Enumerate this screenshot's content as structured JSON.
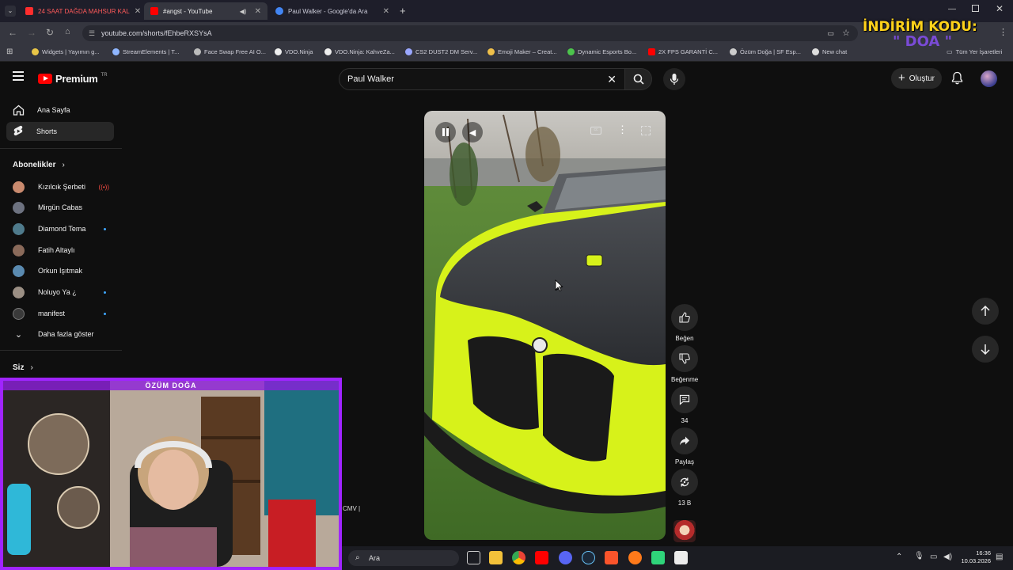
{
  "browser": {
    "tabs": [
      {
        "title": "24 SAAT DAĞDA MAHSUR KAL",
        "color": "#ff2d2d"
      },
      {
        "title": "#angst - YouTube",
        "color": "#ff0000"
      },
      {
        "title": "Paul Walker - Google'da Ara",
        "color": "#4285f4"
      }
    ],
    "url": "youtube.com/shorts/fEhbeRXSYsA",
    "bookmarks": [
      "Widgets | Yayımın g...",
      "StreamElements | T...",
      "Face Swap Free AI O...",
      "VDO.Ninja",
      "VDO.Ninja: KahveZa...",
      "CS2 DUST2 DM Serv...",
      "Emoji Maker – Creat...",
      "Dynamic Esports Bo...",
      "2X FPS GARANTİ C...",
      "Özüm Doğa | SF Esp...",
      "New chat"
    ],
    "bookmarks_folder": "Tüm Yer İşaretleri"
  },
  "promo": {
    "line1": "İNDİRİM KODU:",
    "line2": "\" DOA \""
  },
  "header": {
    "logo_text": "Premium",
    "logo_sup": "TR",
    "search_value": "Paul Walker",
    "create_label": "Oluştur"
  },
  "sidebar": {
    "home": "Ana Sayfa",
    "shorts": "Shorts",
    "subscriptions_title": "Abonelikler",
    "subscriptions": [
      {
        "name": "Kızılcık Şerbeti",
        "badge": "live"
      },
      {
        "name": "Mirgün Cabas",
        "badge": ""
      },
      {
        "name": "Diamond Tema",
        "badge": "dot"
      },
      {
        "name": "Fatih Altaylı",
        "badge": ""
      },
      {
        "name": "Orkun Işıtmak",
        "badge": ""
      },
      {
        "name": "Noluyo Ya ¿",
        "badge": "dot"
      },
      {
        "name": "manifest",
        "badge": "dot"
      }
    ],
    "show_more": "Daha fazla göster",
    "you_title": "Siz"
  },
  "actions": {
    "like": "Beğen",
    "dislike": "Beğenme",
    "comments": "34",
    "share": "Paylaş",
    "remix": "13 B"
  },
  "overlay": {
    "streamer_name": "ÖZÜM DOĞA",
    "cmv_text": "CMV |"
  },
  "taskbar": {
    "search_placeholder": "Ara",
    "time": "16:36",
    "date": "10.03.2026"
  },
  "colors": {
    "accent_red": "#ff0000",
    "overlay_purple": "#a024ff",
    "car_yellow": "#d7f21a",
    "promo_yellow": "#ffd21a"
  }
}
